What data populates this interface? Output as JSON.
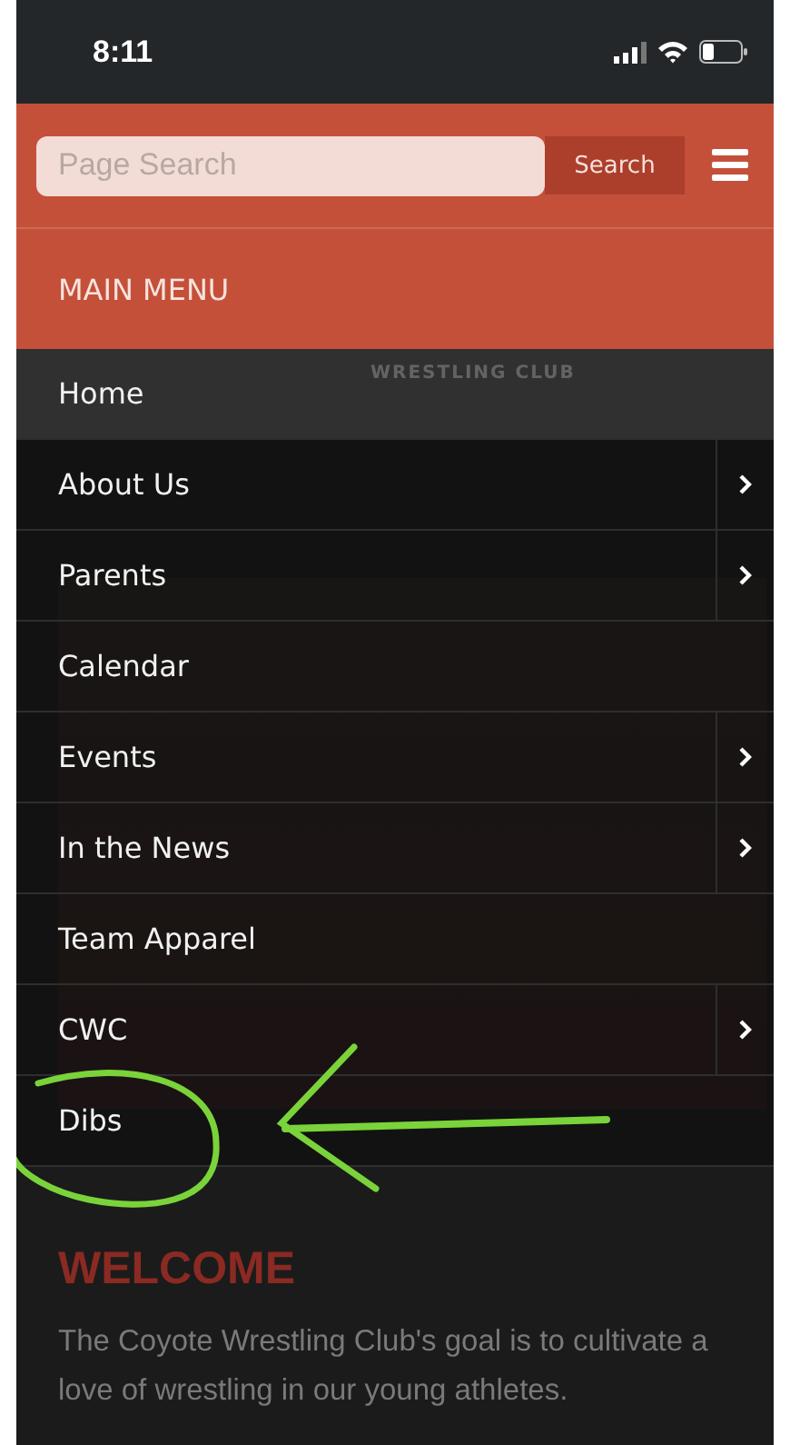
{
  "status_bar": {
    "time": "8:11"
  },
  "header": {
    "search": {
      "placeholder": "Page Search"
    },
    "search_button": "Search"
  },
  "menu": {
    "title": "MAIN MENU",
    "items": [
      {
        "label": "Home",
        "selected": true,
        "expandable": false
      },
      {
        "label": "About Us",
        "selected": false,
        "expandable": true
      },
      {
        "label": "Parents",
        "selected": false,
        "expandable": true
      },
      {
        "label": "Calendar",
        "selected": false,
        "expandable": false
      },
      {
        "label": "Events",
        "selected": false,
        "expandable": true
      },
      {
        "label": "In the News",
        "selected": false,
        "expandable": true
      },
      {
        "label": "Team Apparel",
        "selected": false,
        "expandable": false
      },
      {
        "label": "CWC",
        "selected": false,
        "expandable": true
      },
      {
        "label": "Dibs",
        "selected": false,
        "expandable": false
      }
    ]
  },
  "page": {
    "logo_text": "WRESTLING CLUB",
    "heading": "WELCOME",
    "paragraph": "The Coyote Wrestling Club's goal is to cultivate a love of wrestling in our young athletes."
  }
}
